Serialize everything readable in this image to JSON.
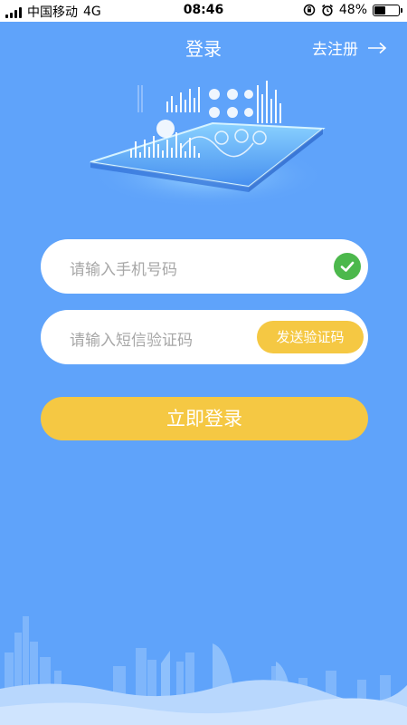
{
  "status_bar": {
    "carrier": "中国移动",
    "network": "4G",
    "time": "08:46",
    "battery_percent": "48%",
    "battery_level": 0.48
  },
  "header": {
    "title": "登录",
    "register_link": "去注册",
    "register_arrow": "arrow-right-icon"
  },
  "form": {
    "phone_placeholder": "请输入手机号码",
    "phone_valid_icon": "check-icon",
    "code_placeholder": "请输入短信验证码",
    "send_code_label": "发送验证码",
    "login_label": "立即登录"
  },
  "colors": {
    "background": "#5fa3fa",
    "accent": "#f5c843",
    "success": "#4cb84c",
    "placeholder": "#a7a7a7"
  }
}
